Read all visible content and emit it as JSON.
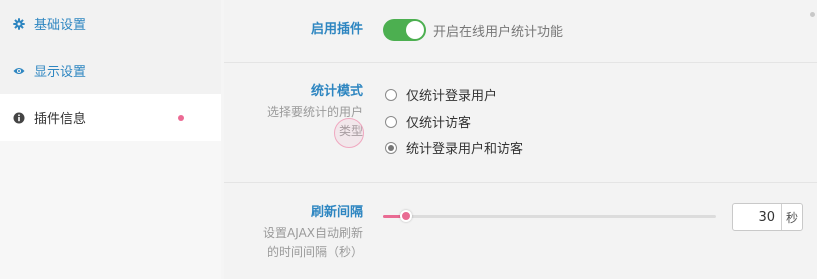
{
  "sidebar": {
    "items": [
      {
        "label": "基础设置",
        "icon": "gear-icon"
      },
      {
        "label": "显示设置",
        "icon": "eye-icon"
      },
      {
        "label": "插件信息",
        "icon": "info-icon"
      }
    ]
  },
  "settings": {
    "enable": {
      "title": "启用插件",
      "toggle_text": "开启在线用户统计功能",
      "on": true
    },
    "mode": {
      "title": "统计模式",
      "desc_line1": "选择要统计的用户",
      "desc_line2": "类型",
      "options": [
        "仅统计登录用户",
        "仅统计访客",
        "统计登录用户和访客"
      ],
      "selected_index": 2
    },
    "interval": {
      "title": "刷新间隔",
      "desc_line1": "设置AJAX自动刷新",
      "desc_line2": "的时间间隔（秒）",
      "value": "30",
      "unit": "秒",
      "slider_fraction": 0.07
    }
  },
  "colors": {
    "accent": "#2e86c1",
    "toggle_on": "#4caf50",
    "slider": "#e96b93"
  }
}
